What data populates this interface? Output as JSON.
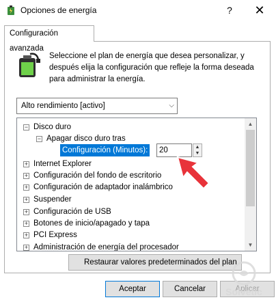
{
  "window": {
    "title": "Opciones de energía",
    "help": "?",
    "close": "✕"
  },
  "tab": {
    "label": "Configuración avanzada"
  },
  "description": "Seleccione el plan de energía que desea personalizar, y después elija la configuración que refleje la forma deseada para administrar la energía.",
  "plan_select": {
    "value": "Alto rendimiento [activo]"
  },
  "tree": {
    "items": [
      {
        "label": "Disco duro",
        "expander": "⊟"
      },
      {
        "label": "Apagar disco duro tras",
        "expander": "⊟"
      },
      {
        "label": "Internet Explorer",
        "expander": "⊞"
      },
      {
        "label": "Configuración del fondo de escritorio",
        "expander": "⊞"
      },
      {
        "label": "Configuración de adaptador inalámbrico",
        "expander": "⊞"
      },
      {
        "label": "Suspender",
        "expander": "⊞"
      },
      {
        "label": "Configuración de USB",
        "expander": "⊞"
      },
      {
        "label": "Botones de inicio/apagado y tapa",
        "expander": "⊞"
      },
      {
        "label": "PCI Express",
        "expander": "⊞"
      },
      {
        "label": "Administración de energía del procesador",
        "expander": "⊞"
      }
    ],
    "setting_label": "Configuración (Minutos):",
    "setting_value": "20"
  },
  "buttons": {
    "restore": "Restaurar valores predeterminados del plan",
    "accept": "Aceptar",
    "cancel": "Cancelar",
    "apply": "Aplicar"
  },
  "watermark": {
    "line1": "Solvetic"
  },
  "colors": {
    "selection": "#0078d7",
    "arrow": "#e8333a",
    "watermark": "#d9d9d9"
  }
}
